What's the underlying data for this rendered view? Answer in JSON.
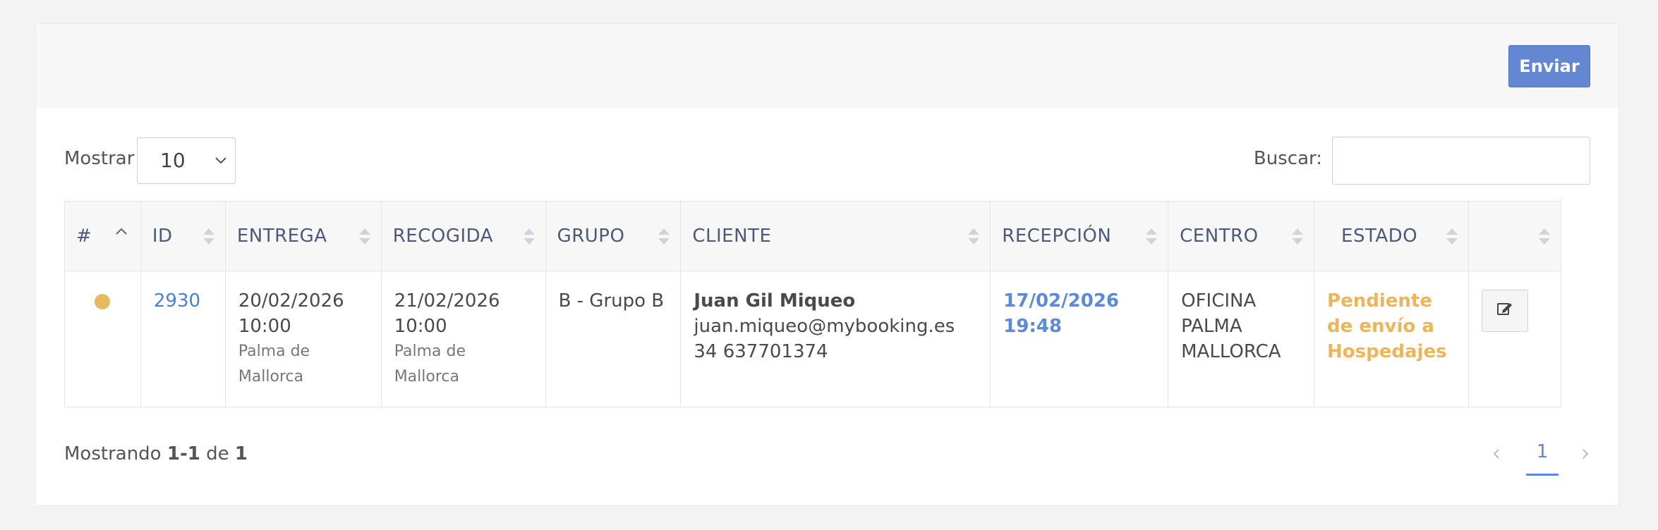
{
  "header": {
    "send_label": "Enviar"
  },
  "controls": {
    "show_label": "Mostrar",
    "page_size": "10",
    "search_label": "Buscar:",
    "search_value": ""
  },
  "table": {
    "columns": [
      "#",
      "ID",
      "ENTREGA",
      "RECOGIDA",
      "GRUPO",
      "CLIENTE",
      "RECEPCIÓN",
      "CENTRO",
      "ESTADO",
      ""
    ],
    "rows": [
      {
        "status_color": "#e8b860",
        "id": "2930",
        "delivery_date": "20/02/2026",
        "delivery_time": "10:00",
        "delivery_place": "Palma de Mallorca",
        "pickup_date": "21/02/2026",
        "pickup_time": "10:00",
        "pickup_place": "Palma de Mallorca",
        "group": "B - Grupo B",
        "client_name": "Juan Gil Miqueo",
        "client_email": "juan.miqueo@mybooking.es",
        "client_phone": "34 637701374",
        "reception": "17/02/2026 19:48",
        "center": "OFICINA PALMA MALLORCA",
        "status": "Pendiente de envío a Hospedajes"
      }
    ]
  },
  "footer": {
    "showing_prefix": "Mostrando",
    "range": "1-1",
    "of": "de",
    "total": "1",
    "current_page": "1"
  },
  "icons": {
    "edit": "edit-icon",
    "prev": "chevron-left-icon",
    "next": "chevron-right-icon"
  }
}
